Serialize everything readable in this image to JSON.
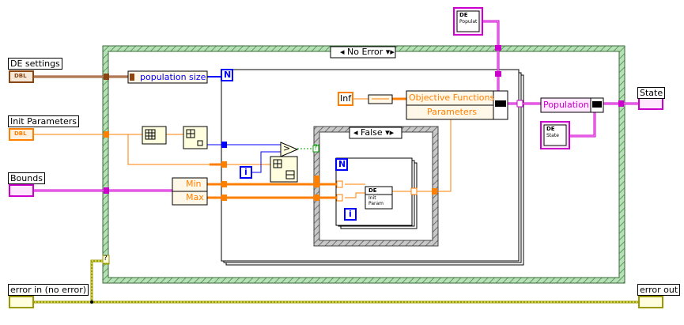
{
  "case_structures": {
    "outer": {
      "selector": "No Error"
    },
    "inner": {
      "selector": "False"
    }
  },
  "controls": {
    "de_settings": {
      "label": "DE settings",
      "type_badge": "DBL"
    },
    "init_parameters": {
      "label": "Init Parameters",
      "type_badge": "DBL"
    },
    "bounds": {
      "label": "Bounds"
    },
    "error_in": {
      "label": "error in (no error)"
    }
  },
  "indicators": {
    "state": {
      "label": "State"
    },
    "error_out": {
      "label": "error out"
    }
  },
  "nodes": {
    "population_size": "population size",
    "loop_count_terminal": "N",
    "iteration_terminal": "i",
    "inf_constant": "Inf",
    "objective_functions": "Objective Functions",
    "parameters": "Parameters",
    "min": "Min",
    "max": "Max",
    "population": "Population",
    "de_label": "DE",
    "init_param_line1": "Init",
    "init_param_line2": "Param",
    "populat": "Populat",
    "state_cluster": "State",
    "greater_symbol": ">",
    "error_query": "?"
  },
  "colors": {
    "dbl_orange": "#ff7f00",
    "cluster_brown": "#8b4513",
    "cluster_pink": "#cc00cc",
    "integer_blue": "#0000ff",
    "error_wire": "#9a9a00",
    "case_frame_green": "#86c28a",
    "case_frame_border": "#3a6a3a"
  }
}
